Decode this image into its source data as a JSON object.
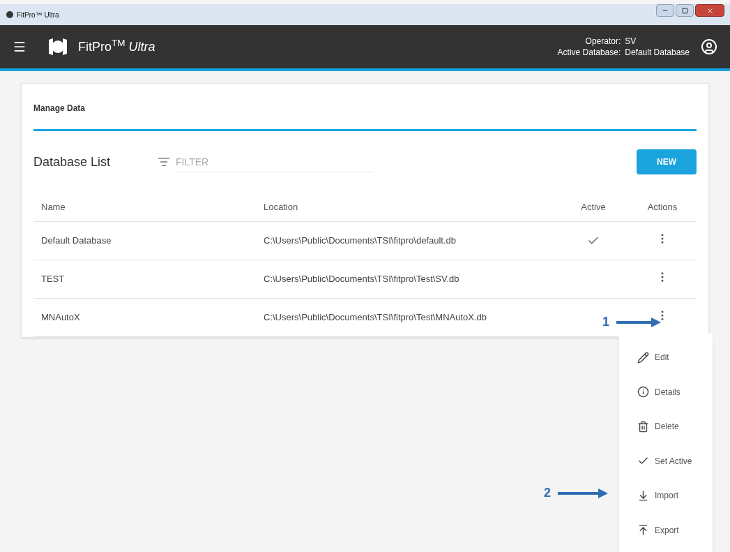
{
  "window": {
    "title": "FitPro™ Ultra"
  },
  "app_bar": {
    "brand": "FitPro$^{TM}$ *Ultra*",
    "operator_label": "Operator:",
    "operator": "SV",
    "database_label": "Active Database:",
    "database": "Default Database"
  },
  "tabs": [
    {
      "label": "Manage Data",
      "selected": true
    }
  ],
  "database_list": {
    "title": "Database List",
    "filter": {
      "placeholder": "FILTER"
    },
    "new_button": "NEW"
  },
  "table": {
    "columns": [
      "Name",
      "Location",
      "Active",
      "Actions"
    ],
    "rows": [
      {
        "name": "Default Database",
        "location": "C:\\Users\\Public\\Documents\\TSI\\fitpro\\default.db",
        "active": true
      },
      {
        "name": "TEST",
        "location": "C:\\Users\\Public\\Documents\\TSI\\fitpro\\Test\\SV.db",
        "active": false
      },
      {
        "name": "MNAutoX",
        "location": "C:\\Users\\Public\\Documents\\TSI\\fitpro\\Test\\MNAutoX.db",
        "active": false
      }
    ]
  },
  "actions_menu": {
    "items": [
      {
        "kind": "edit",
        "label": "Edit"
      },
      {
        "kind": "details",
        "label": "Details"
      },
      {
        "kind": "delete",
        "label": "Delete"
      },
      {
        "kind": "set_active",
        "label": "Set Active"
      },
      {
        "kind": "import",
        "label": "Import"
      },
      {
        "kind": "export",
        "label": "Export"
      }
    ]
  },
  "annotations": [
    {
      "label": "1"
    },
    {
      "label": "2"
    }
  ]
}
